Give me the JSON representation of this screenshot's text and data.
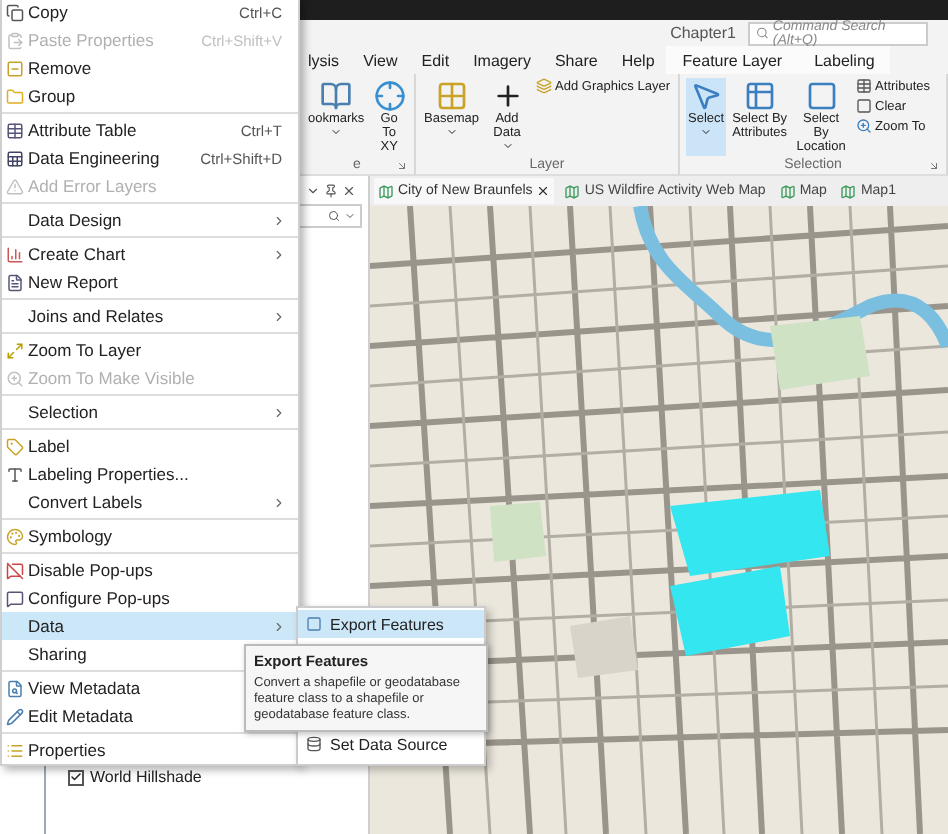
{
  "top_bar": {
    "project": "Chapter1",
    "search": {
      "placeholder": "Command Search (Alt+Q)"
    }
  },
  "ribbon_tabs": [
    {
      "label": "lysis",
      "kind": "core"
    },
    {
      "label": "View",
      "kind": "core"
    },
    {
      "label": "Edit",
      "kind": "core"
    },
    {
      "label": "Imagery",
      "kind": "core"
    },
    {
      "label": "Share",
      "kind": "core"
    },
    {
      "label": "Help",
      "kind": "core"
    },
    {
      "label": "Feature Layer",
      "kind": "contextual"
    },
    {
      "label": "Labeling",
      "kind": "contextual"
    }
  ],
  "ribbon_groups": [
    {
      "label": "e",
      "launcher": true,
      "buttons": [
        {
          "label": "ookmarks",
          "kind": "large",
          "dropdown": true,
          "pressed": false
        },
        {
          "label": "Go To XY",
          "kind": "large",
          "pressed": false
        }
      ]
    },
    {
      "label": "Layer",
      "buttons": [
        {
          "label": "Basemap",
          "kind": "large",
          "dropdown": true,
          "pressed": false
        },
        {
          "label": "Add Data",
          "kind": "large",
          "dropdown": true,
          "pressed": false
        },
        {
          "label": "Add Graphics Layer",
          "kind": "small"
        }
      ]
    },
    {
      "label": "Selection",
      "launcher": true,
      "buttons": [
        {
          "label": "Select",
          "kind": "large",
          "dropdown": true,
          "pressed": true
        },
        {
          "label": "Select By Attributes",
          "kind": "large",
          "pressed": false
        },
        {
          "label": "Select By Location",
          "kind": "large",
          "pressed": false
        },
        {
          "label": "Attributes",
          "kind": "small"
        },
        {
          "label": "Clear",
          "kind": "small"
        },
        {
          "label": "Zoom To",
          "kind": "small"
        }
      ]
    }
  ],
  "map_tabs": [
    {
      "label": "City of New Braunfels",
      "closable": true,
      "selected": true
    },
    {
      "label": "US Wildfire Activity Web Map",
      "closable": false,
      "selected": false
    },
    {
      "label": "Map",
      "closable": false,
      "selected": false
    },
    {
      "label": "Map1",
      "closable": false,
      "selected": false
    }
  ],
  "contents_pane": {
    "layer": {
      "label": "World Hillshade",
      "checked": true
    }
  },
  "context_menu": {
    "sections": [
      {
        "items": [
          {
            "label": "Copy",
            "shortcut": "Ctrl+C",
            "submenu": false,
            "disabled": false,
            "selected": false
          },
          {
            "label": "Paste Properties",
            "shortcut": "Ctrl+Shift+V",
            "submenu": false,
            "disabled": true,
            "selected": false
          },
          {
            "label": "Remove",
            "submenu": false,
            "disabled": false,
            "selected": false
          },
          {
            "label": "Group",
            "submenu": false,
            "disabled": false,
            "selected": false
          }
        ]
      },
      {
        "items": [
          {
            "label": "Attribute Table",
            "shortcut": "Ctrl+T",
            "submenu": false,
            "disabled": false,
            "selected": false
          },
          {
            "label": "Data Engineering",
            "shortcut": "Ctrl+Shift+D",
            "submenu": false,
            "disabled": false,
            "selected": false
          },
          {
            "label": "Add Error Layers",
            "submenu": false,
            "disabled": true,
            "selected": false
          }
        ]
      },
      {
        "items": [
          {
            "label": "Data Design",
            "submenu": true,
            "disabled": false,
            "selected": false
          }
        ]
      },
      {
        "items": [
          {
            "label": "Create Chart",
            "submenu": true,
            "disabled": false,
            "selected": false
          },
          {
            "label": "New Report",
            "submenu": false,
            "disabled": false,
            "selected": false
          }
        ]
      },
      {
        "items": [
          {
            "label": "Joins and Relates",
            "submenu": true,
            "disabled": false,
            "selected": false
          }
        ]
      },
      {
        "items": [
          {
            "label": "Zoom To Layer",
            "submenu": false,
            "disabled": false,
            "selected": false
          },
          {
            "label": "Zoom To Make Visible",
            "submenu": false,
            "disabled": true,
            "selected": false
          }
        ]
      },
      {
        "items": [
          {
            "label": "Selection",
            "submenu": true,
            "disabled": false,
            "selected": false
          }
        ]
      },
      {
        "items": [
          {
            "label": "Label",
            "submenu": false,
            "disabled": false,
            "selected": false
          },
          {
            "label": "Labeling Properties...",
            "submenu": false,
            "disabled": false,
            "selected": false
          },
          {
            "label": "Convert Labels",
            "submenu": true,
            "disabled": false,
            "selected": false
          }
        ]
      },
      {
        "items": [
          {
            "label": "Symbology",
            "submenu": false,
            "disabled": false,
            "selected": false
          }
        ]
      },
      {
        "items": [
          {
            "label": "Disable Pop-ups",
            "submenu": false,
            "disabled": false,
            "selected": false
          },
          {
            "label": "Configure Pop-ups",
            "submenu": false,
            "disabled": false,
            "selected": false
          },
          {
            "label": "Data",
            "submenu": true,
            "disabled": false,
            "selected": true
          },
          {
            "label": "Sharing",
            "disabled": false,
            "selected": false
          }
        ]
      },
      {
        "items": [
          {
            "label": "View Metadata",
            "disabled": false,
            "selected": false
          },
          {
            "label": "Edit Metadata",
            "disabled": false,
            "selected": false
          }
        ]
      },
      {
        "items": [
          {
            "label": "Properties",
            "submenu": false,
            "disabled": false,
            "selected": false
          }
        ]
      }
    ]
  },
  "submenu": {
    "items": [
      {
        "label": "Export Features",
        "selected": true
      },
      {
        "label": "Set Data Source",
        "selected": false
      }
    ]
  },
  "tooltip": {
    "title": "Export Features",
    "text": "Convert a shapefile or geodatabase feature class to a shapefile or geodatabase feature class."
  }
}
